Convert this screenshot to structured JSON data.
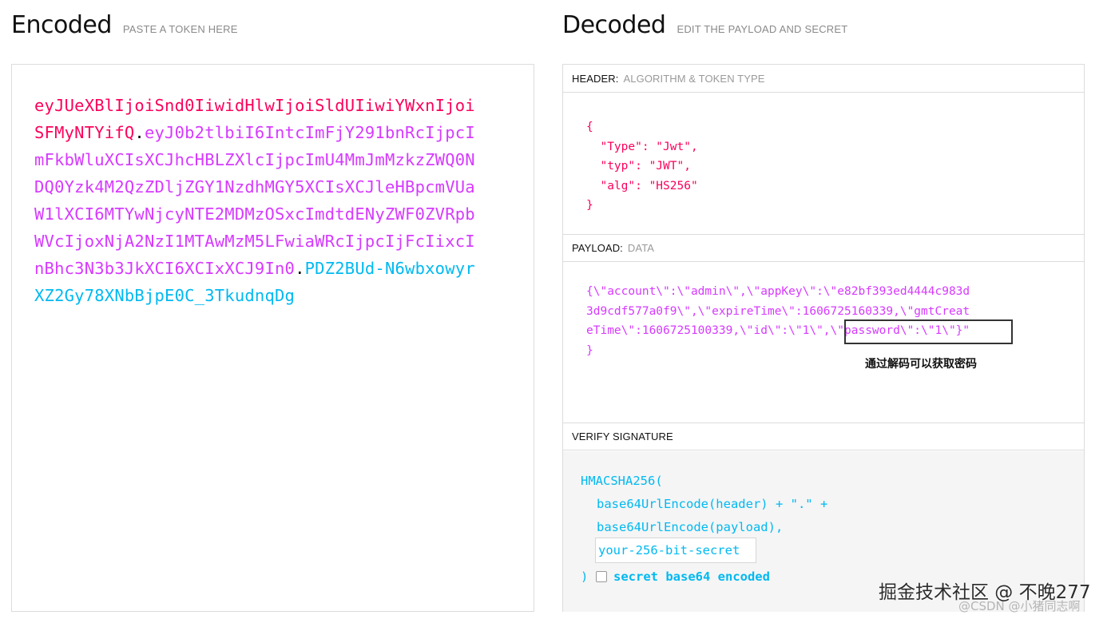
{
  "encoded": {
    "title": "Encoded",
    "subtitle": "PASTE A TOKEN HERE",
    "token_header": "eyJUeXBlIjoiSnd0IiwidHlwIjoiSldUIiwiYWxnIjoiSFMyNTYifQ",
    "dot1": ".",
    "token_payload": "eyJ0b2tlbiI6IntcImFjY291bnRcIjpcImFkbWluXCIsXCJhcHBLZXlcIjpcImU4MmJmMzkzZWQ0NDQ0Yzk4M2QzZDljZGY1NzdhMGY5XCIsXCJleHBpcmVUaW1lXCI6MTYwNjcyNTE2MDMzOSxcImdtdENyZWF0ZVRpbWVcIjoxNjA2NzI1MTAwMzM5LFwiaWRcIjpcIjFcIixcInBhc3N3b3JkXCI6XCIxXCJ9In0",
    "dot2": ".",
    "token_signature": "PDZ2BUd-N6wbxowyrXZ2Gy78XNbBjpE0C_3TkudnqDg"
  },
  "decoded": {
    "title": "Decoded",
    "subtitle": "EDIT THE PAYLOAD AND SECRET",
    "header_label": "HEADER:",
    "header_sub": "ALGORITHM & TOKEN TYPE",
    "header_json": "{\n  \"Type\": \"Jwt\",\n  \"typ\": \"JWT\",\n  \"alg\": \"HS256\"\n}",
    "payload_label": "PAYLOAD:",
    "payload_sub": "DATA",
    "payload_json": "{\\\"account\\\":\\\"admin\\\",\\\"appKey\\\":\\\"e82bf393ed4444c983d\n3d9cdf577a0f9\\\",\\\"expireTime\\\":1606725160339,\\\"gmtCreat\neTime\\\":1606725100339,\\\"id\\\":\\\"1\\\",\\\"password\\\":\\\"1\\\"}\"\n}",
    "password_note": "通过解码可以获取密码",
    "verify_label": "VERIFY SIGNATURE",
    "verify_l1": "HMACSHA256(",
    "verify_l2": "base64UrlEncode(header) + \".\" +",
    "verify_l3": "base64UrlEncode(payload),",
    "secret_placeholder": "your-256-bit-secret",
    "verify_close": ")",
    "secret_b64_label": "secret base64 encoded",
    "secret_b64_checked": false
  },
  "watermark": {
    "main": "掘金技术社区 @ 不晚277",
    "secondary": "@CSDN @小猪同志啊"
  }
}
